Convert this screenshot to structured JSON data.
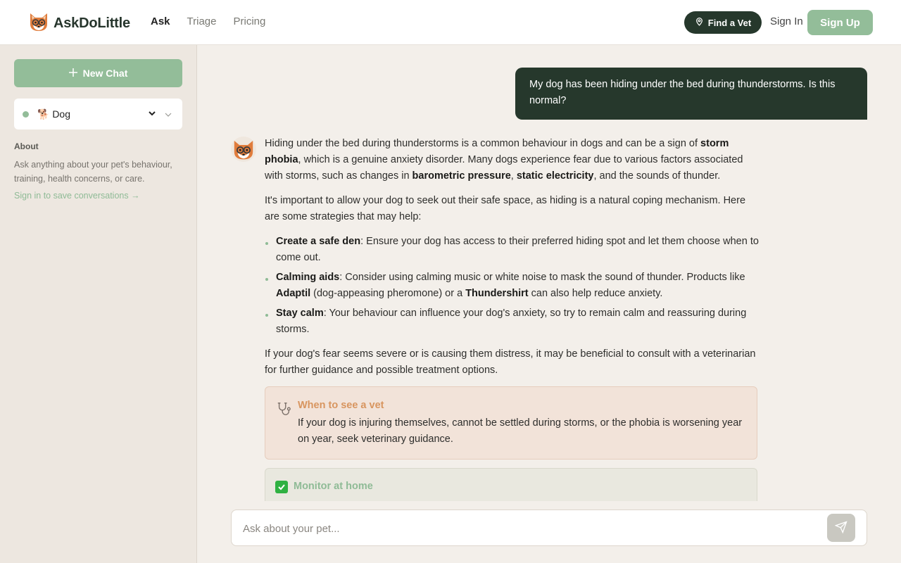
{
  "header": {
    "brand": "AskDoLittle",
    "nav": [
      "Ask",
      "Triage",
      "Pricing"
    ],
    "find_vet": "Find a Vet",
    "sign_in": "Sign In",
    "sign_up": "Sign Up"
  },
  "sidebar": {
    "new_chat": "New Chat",
    "pet_select": "🐕 Dog",
    "about_title": "About",
    "about_text": "Ask anything about your pet's behaviour, training, health concerns, or care.",
    "signin_link": "Sign in to save conversations →"
  },
  "chat": {
    "user_message": "My dog has been hiding under the bed during thunderstorms. Is this normal?",
    "bot": {
      "p1": {
        "a": "Hiding under the bed during thunderstorms is a common behaviour in dogs and can be a sign of ",
        "b1": "storm phobia",
        "c": ", which is a genuine anxiety disorder. Many dogs experience fear due to various factors associated with storms, such as changes in ",
        "b2": "barometric pressure",
        "d": ", ",
        "b3": "static electricity",
        "e": ", and the sounds of thunder."
      },
      "p2": "It's important to allow your dog to seek out their safe space, as hiding is a natural coping mechanism. Here are some strategies that may help:",
      "tips": [
        {
          "title": "Create a safe den",
          "text": ": Ensure your dog has access to their preferred hiding spot and let them choose when to come out."
        },
        {
          "title": "Calming aids",
          "text1": ": Consider using calming music or white noise to mask the sound of thunder. Products like ",
          "b1": "Adaptil",
          "text2": " (dog-appeasing pheromone) or a ",
          "b2": "Thundershirt",
          "text3": " can also help reduce anxiety."
        },
        {
          "title": "Stay calm",
          "text": ": Your behaviour can influence your dog's anxiety, so try to remain calm and reassuring during storms."
        }
      ],
      "p3": "If your dog's fear seems severe or is causing them distress, it may be beneficial to consult with a veterinarian for further guidance and possible treatment options.",
      "vet_card": {
        "title": "When to see a vet",
        "text": "If your dog is injuring themselves, cannot be settled during storms, or the phobia is worsening year on year, seek veterinary guidance."
      },
      "home_card": {
        "title": "Monitor at home"
      }
    }
  },
  "composer": {
    "placeholder": "Ask about your pet..."
  },
  "icons": {
    "logo": "fox-with-glasses-icon",
    "find_vet": "map-pin-icon",
    "new_chat": "plus-icon",
    "pet_chevron": "chevron-down-icon",
    "vet_card": "stethoscope-icon",
    "home_card": "check-square-icon",
    "send": "send-icon"
  },
  "colors": {
    "brand_dark": "#26382c",
    "brand_green": "#93bd99",
    "vet_accent": "#d8955f",
    "check_green": "#2fb142"
  }
}
